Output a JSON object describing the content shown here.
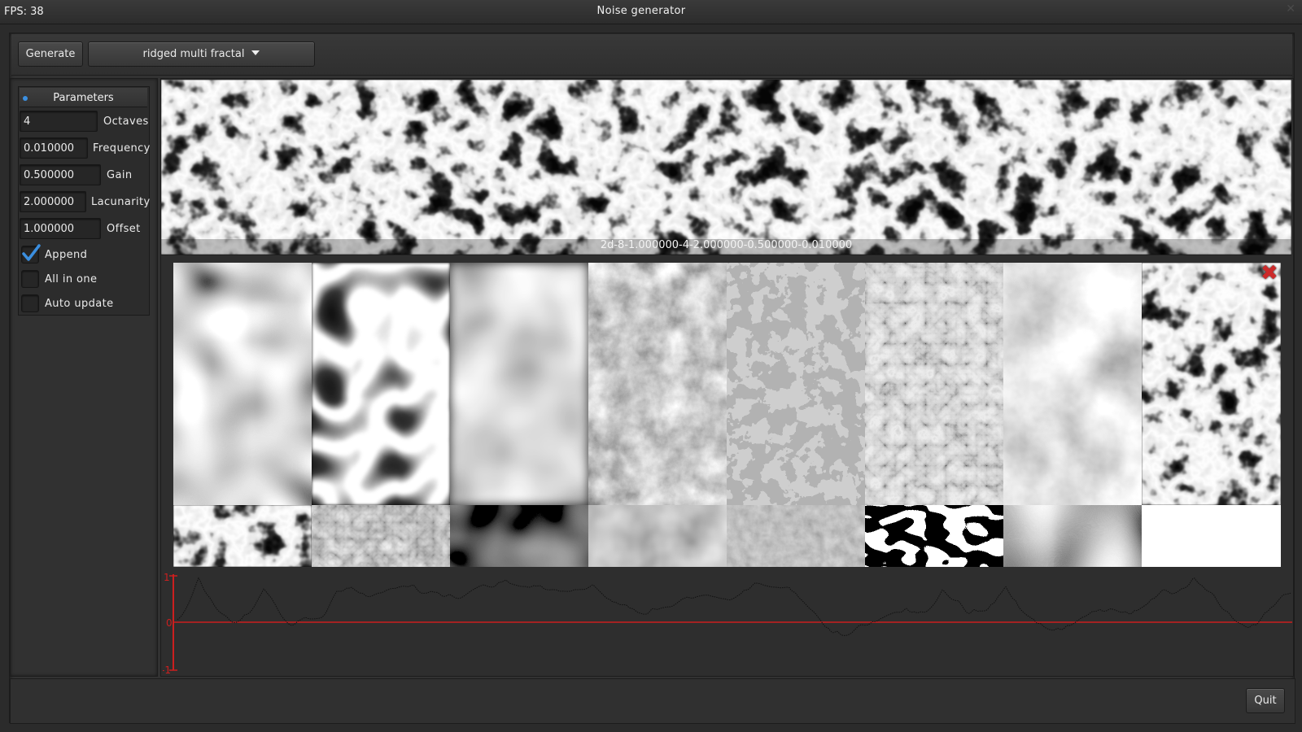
{
  "window": {
    "title": "Noise generator",
    "fps_label": "FPS: 38",
    "close_glyph": "✕"
  },
  "toolbar": {
    "generate_label": "Generate",
    "algorithm_selected": "ridged multi fractal",
    "algorithm_options": [
      "ridged multi fractal"
    ]
  },
  "parameters": {
    "title": "Parameters",
    "octaves": {
      "label": "Octaves",
      "value": "4"
    },
    "frequency": {
      "label": "Frequency",
      "value": "0.010000"
    },
    "gain": {
      "label": "Gain",
      "value": "0.500000"
    },
    "lacunarity": {
      "label": "Lacunarity",
      "value": "2.000000"
    },
    "offset": {
      "label": "Offset",
      "value": "1.000000"
    },
    "append": {
      "label": "Append",
      "checked": true
    },
    "all_in_one": {
      "label": "All in one",
      "checked": false
    },
    "auto_update": {
      "label": "Auto update",
      "checked": false
    }
  },
  "preview": {
    "caption": "2d-8-1.000000-4-2.000000-0.500000-0.010000"
  },
  "tiles": {
    "large": [
      "simplex-blobs",
      "ridged-white-lines",
      "blurry-noise",
      "cloudy-fbm",
      "patchy-cellular",
      "turbulent-marble",
      "cloudy-smooth",
      "ridged-multifractal"
    ],
    "small": [
      "ridged-dark",
      "rocky-texture",
      "dark-smooth",
      "foggy",
      "grainy",
      "black-white-spots",
      "swirl-rings",
      "flat-white"
    ]
  },
  "plot": {
    "y_ticks": [
      "1",
      "0",
      "-1"
    ],
    "axis_color": "#cc1f1f",
    "line_color": "#111111"
  },
  "footer": {
    "quit_label": "Quit"
  },
  "colors": {
    "accent": "#3b8fe0",
    "close_red": "#cc2a2a"
  }
}
